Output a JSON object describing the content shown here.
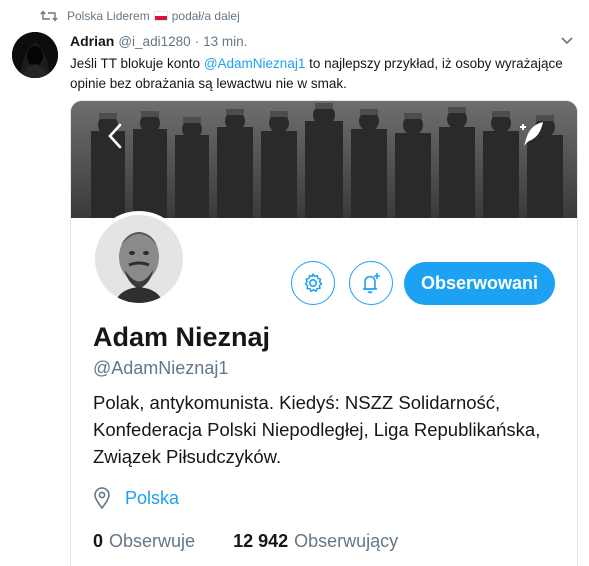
{
  "retweet": {
    "user": "Polska Liderem",
    "action": "podał/a dalej"
  },
  "tweet": {
    "author_name": "Adrian",
    "author_handle": "@i_adi1280",
    "separator": "·",
    "time": "13 min.",
    "text_before": "Jeśli TT blokuje konto ",
    "mention": "@AdamNieznaj1",
    "text_after": " to najlepszy przykład, iż osoby wyrażające opinie bez obrażania są lewactwu nie w smak."
  },
  "profile_card": {
    "display_name": "Adam Nieznaj",
    "screen_name": "@AdamNieznaj1",
    "bio": "Polak, antykomunista. Kiedyś: NSZZ Solidarność, Konfederacja Polski Niepodległej, Liga Republikańska, Związek Piłsudczyków.",
    "location": "Polska",
    "follow_button_label": "Obserwowani",
    "following_count": "0",
    "following_label": "Obserwuje",
    "followers_count": "12 942",
    "followers_label": "Obserwujący"
  },
  "icons": {
    "retweet": "retweet-icon",
    "caret": "chevron-down-icon",
    "back": "chevron-left-icon",
    "quill": "quill-icon",
    "settings": "gear-icon",
    "notifications": "bell-plus-icon",
    "location": "location-pin-icon"
  },
  "colors": {
    "accent": "#1da1f2",
    "secondary_text": "#657786",
    "primary_text": "#14171a",
    "border": "#e1e8ed"
  }
}
